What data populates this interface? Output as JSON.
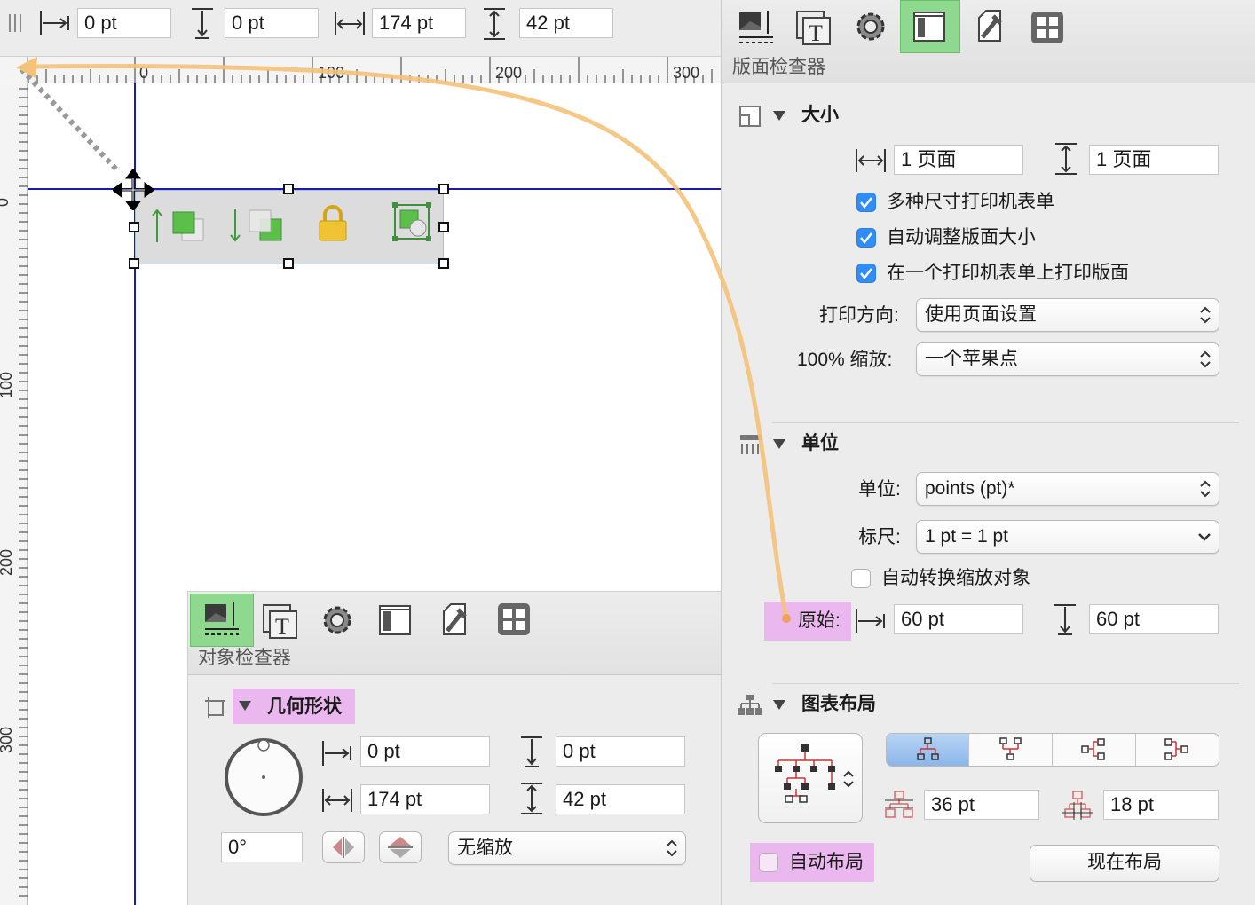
{
  "toolbar": {
    "x_value": "0 pt",
    "y_value": "0 pt",
    "width_value": "174 pt",
    "height_value": "42 pt"
  },
  "ruler": {
    "h_ticks": [
      "0",
      "100",
      "200",
      "300"
    ],
    "v_ticks": [
      "0",
      "100",
      "200",
      "300"
    ]
  },
  "object_inspector": {
    "title": "对象检查器",
    "section_title": "几何形状",
    "x_value": "0 pt",
    "y_value": "0 pt",
    "width_value": "174 pt",
    "height_value": "42 pt",
    "rotation_value": "0°",
    "scale_select": "无缩放"
  },
  "canvas_inspector": {
    "title": "版面检查器",
    "size": {
      "section_title": "大小",
      "pages_wide": "1 页面",
      "pages_high": "1 页面",
      "check_multi_sizes": "多种尺寸打印机表单",
      "check_auto_adjust": "自动调整版面大小",
      "check_one_page": "在一个打印机表单上打印版面",
      "orientation_label": "打印方向:",
      "orientation_value": "使用页面设置",
      "scale_label": "100% 缩放:",
      "scale_value": "一个苹果点"
    },
    "units": {
      "section_title": "单位",
      "units_label": "单位:",
      "units_value": "points (pt)*",
      "ruler_label": "标尺:",
      "ruler_value": "1 pt = 1 pt",
      "auto_convert_label": "自动转换缩放对象",
      "origin_label": "原始:",
      "origin_x": "60 pt",
      "origin_y": "60 pt"
    },
    "layout": {
      "section_title": "图表布局",
      "spacing_a": "36 pt",
      "spacing_b": "18 pt",
      "auto_layout_label": "自动布局",
      "layout_now_button": "现在布局"
    }
  },
  "colors": {
    "active_tab": "#8fd88f",
    "highlight": "#eab8ee",
    "guide": "#1c1ca8",
    "checkbox": "#2f8df5",
    "annotation_arrow": "#f5c27a"
  }
}
